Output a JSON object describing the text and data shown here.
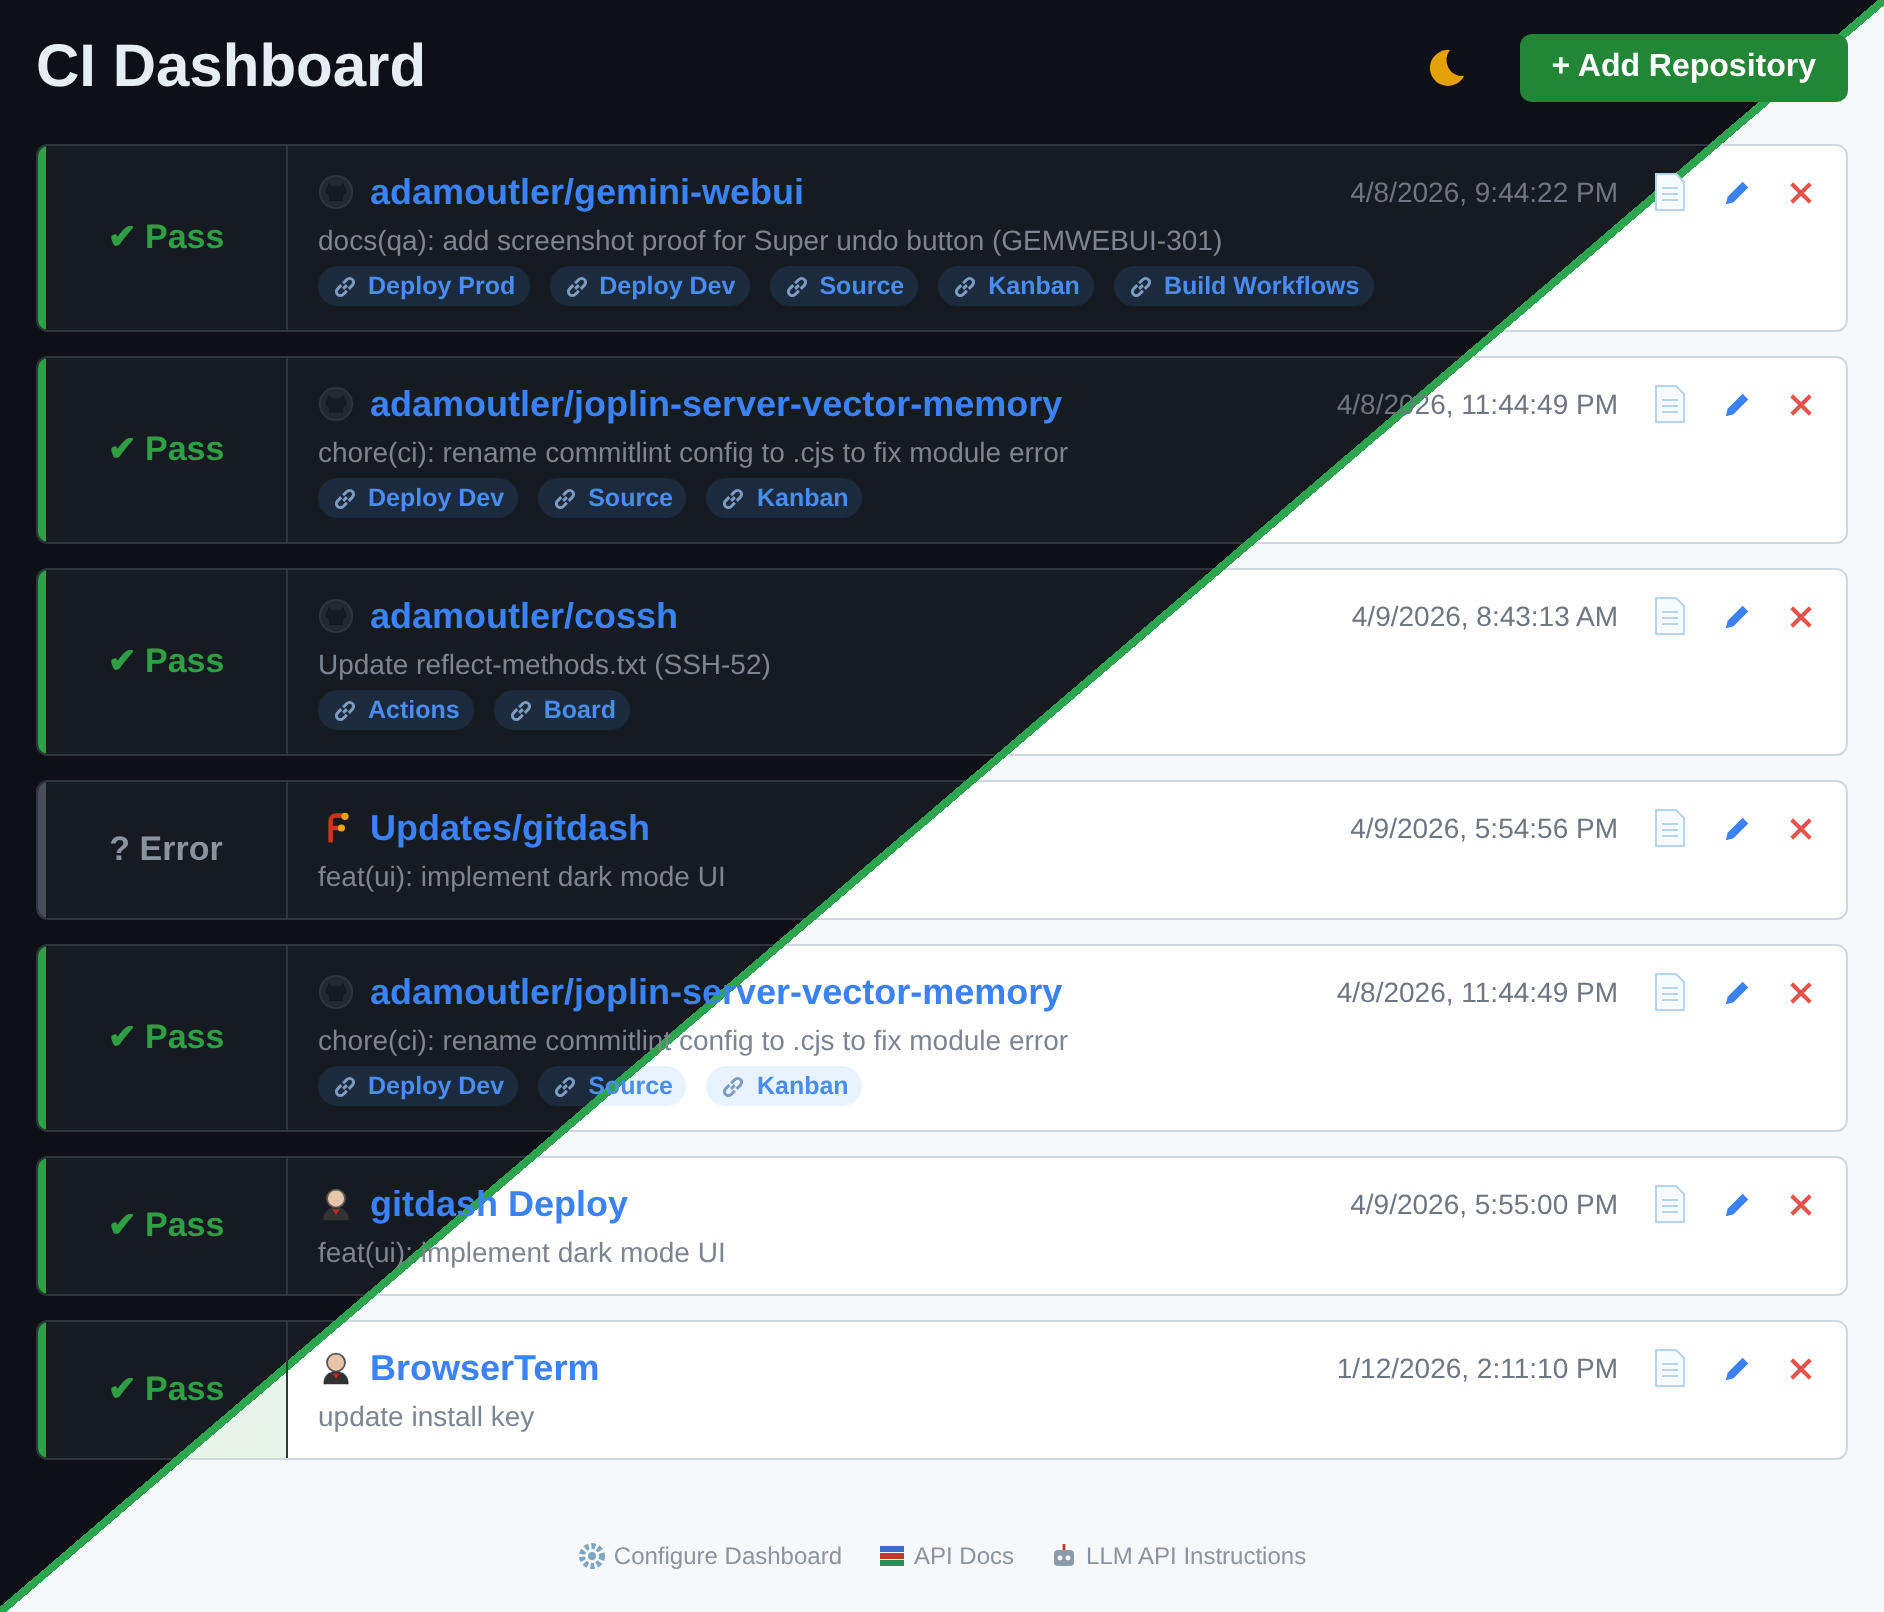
{
  "header": {
    "title": "CI Dashboard",
    "add_button": "+ Add Repository"
  },
  "repos": [
    {
      "status": {
        "text": "✔ Pass",
        "kind": "pass"
      },
      "source": {
        "kind": "github"
      },
      "name": "adamoutler/gemini-webui",
      "time": "4/8/2026, 9:44:22 PM",
      "message": "docs(qa): add screenshot proof for Super undo button (GEMWEBUI-301)",
      "links": [
        "Deploy Prod",
        "Deploy Dev",
        "Source",
        "Kanban",
        "Build Workflows"
      ]
    },
    {
      "status": {
        "text": "✔ Pass",
        "kind": "pass"
      },
      "source": {
        "kind": "github"
      },
      "name": "adamoutler/joplin-server-vector-memory",
      "time": "4/8/2026, 11:44:49 PM",
      "message": "chore(ci): rename commitlint config to .cjs to fix module error",
      "links": [
        "Deploy Dev",
        "Source",
        "Kanban"
      ]
    },
    {
      "status": {
        "text": "✔ Pass",
        "kind": "pass"
      },
      "source": {
        "kind": "github"
      },
      "name": "adamoutler/cossh",
      "time": "4/9/2026, 8:43:13 AM",
      "message": "Update reflect-methods.txt (SSH-52)",
      "links": [
        "Actions",
        "Board"
      ]
    },
    {
      "status": {
        "text": "? Error",
        "kind": "error"
      },
      "source": {
        "kind": "forge"
      },
      "name": "Updates/gitdash",
      "time": "4/9/2026, 5:54:56 PM",
      "message": "feat(ui): implement dark mode UI"
    },
    {
      "status": {
        "text": "✔ Pass",
        "kind": "pass"
      },
      "source": {
        "kind": "github"
      },
      "name": "adamoutler/joplin-server-vector-memory",
      "time": "4/8/2026, 11:44:49 PM",
      "message": "chore(ci): rename commitlint config to .cjs to fix module error",
      "links": [
        "Deploy Dev",
        "Source",
        "Kanban"
      ]
    },
    {
      "status": {
        "text": "✔ Pass",
        "kind": "pass"
      },
      "source": {
        "kind": "butler"
      },
      "name": "gitdash Deploy",
      "time": "4/9/2026, 5:55:00 PM",
      "message": "feat(ui): implement dark mode UI"
    },
    {
      "status": {
        "text": "✔ Pass",
        "kind": "pass"
      },
      "source": {
        "kind": "butler"
      },
      "name": "BrowserTerm",
      "time": "1/12/2026, 2:11:10 PM",
      "message": "update install key"
    }
  ],
  "footer": [
    {
      "kind": "gear",
      "label": "Configure Dashboard"
    },
    {
      "kind": "books",
      "label": "API Docs"
    },
    {
      "kind": "robot",
      "label": "LLM API Instructions"
    }
  ]
}
